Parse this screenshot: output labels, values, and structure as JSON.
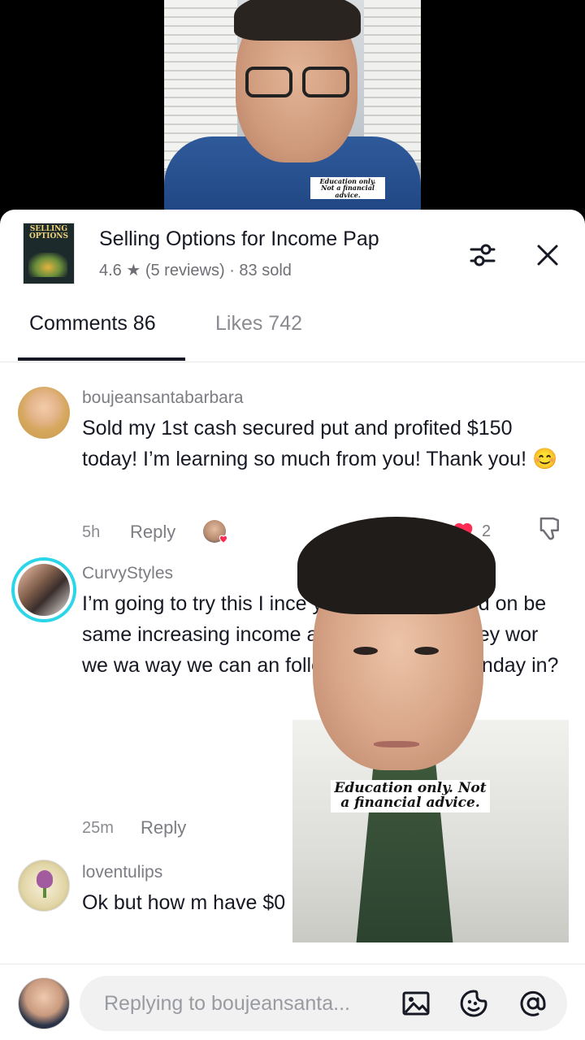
{
  "video_caption": "Education only. Not a financial advice.",
  "product": {
    "thumbnail_text": "SELLING OPTIONS",
    "title": "Selling Options for Income Pap",
    "meta": "4.6 ★ (5 reviews) · 83 sold"
  },
  "tabs": {
    "comments": "Comments 86",
    "likes": "Likes 742"
  },
  "comments": [
    {
      "username": "boujeansantabarbara",
      "text": "Sold my 1st cash secured put and profited $150 today! I’m learning so much from you! Thank you! 😊",
      "time": "5h",
      "reply": "Reply",
      "likes": "2"
    },
    {
      "username": "CurvyStyles",
      "text": "I’m going to try this I ince you started focused on be same increasing income an making my money wor we wa way we can an follow you post on Monday in?",
      "time": "25m",
      "reply": "Reply"
    },
    {
      "username": "loventulips",
      "text": "Ok but how m have $0"
    }
  ],
  "reply_bar": {
    "placeholder": "Replying to boujeansanta..."
  },
  "colors": {
    "like_red": "#fe2c55",
    "story_ring": "#2ad6e8"
  }
}
